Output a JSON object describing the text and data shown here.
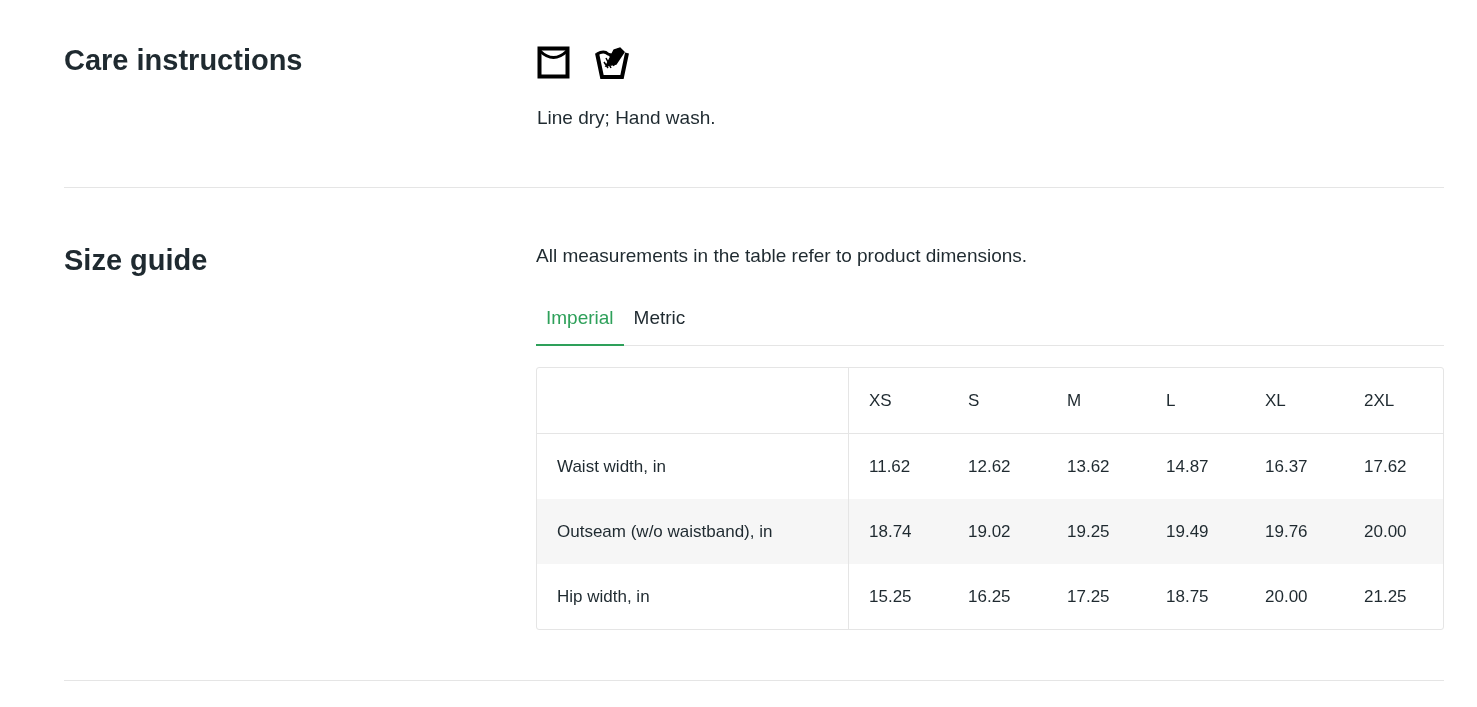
{
  "care": {
    "heading": "Care instructions",
    "text": "Line dry; Hand wash."
  },
  "size_guide": {
    "heading": "Size guide",
    "note": "All measurements in the table refer to product dimensions.",
    "tabs": [
      {
        "label": "Imperial",
        "selected": true
      },
      {
        "label": "Metric",
        "selected": false
      }
    ],
    "table": {
      "columns": [
        "XS",
        "S",
        "M",
        "L",
        "XL",
        "2XL"
      ],
      "rows": [
        {
          "label": "Waist width, in",
          "values": [
            "11.62",
            "12.62",
            "13.62",
            "14.87",
            "16.37",
            "17.62"
          ]
        },
        {
          "label": "Outseam (w/o waistband), in",
          "values": [
            "18.74",
            "19.02",
            "19.25",
            "19.49",
            "19.76",
            "20.00"
          ]
        },
        {
          "label": "Hip width, in",
          "values": [
            "15.25",
            "16.25",
            "17.25",
            "18.75",
            "20.00",
            "21.25"
          ]
        }
      ]
    }
  }
}
